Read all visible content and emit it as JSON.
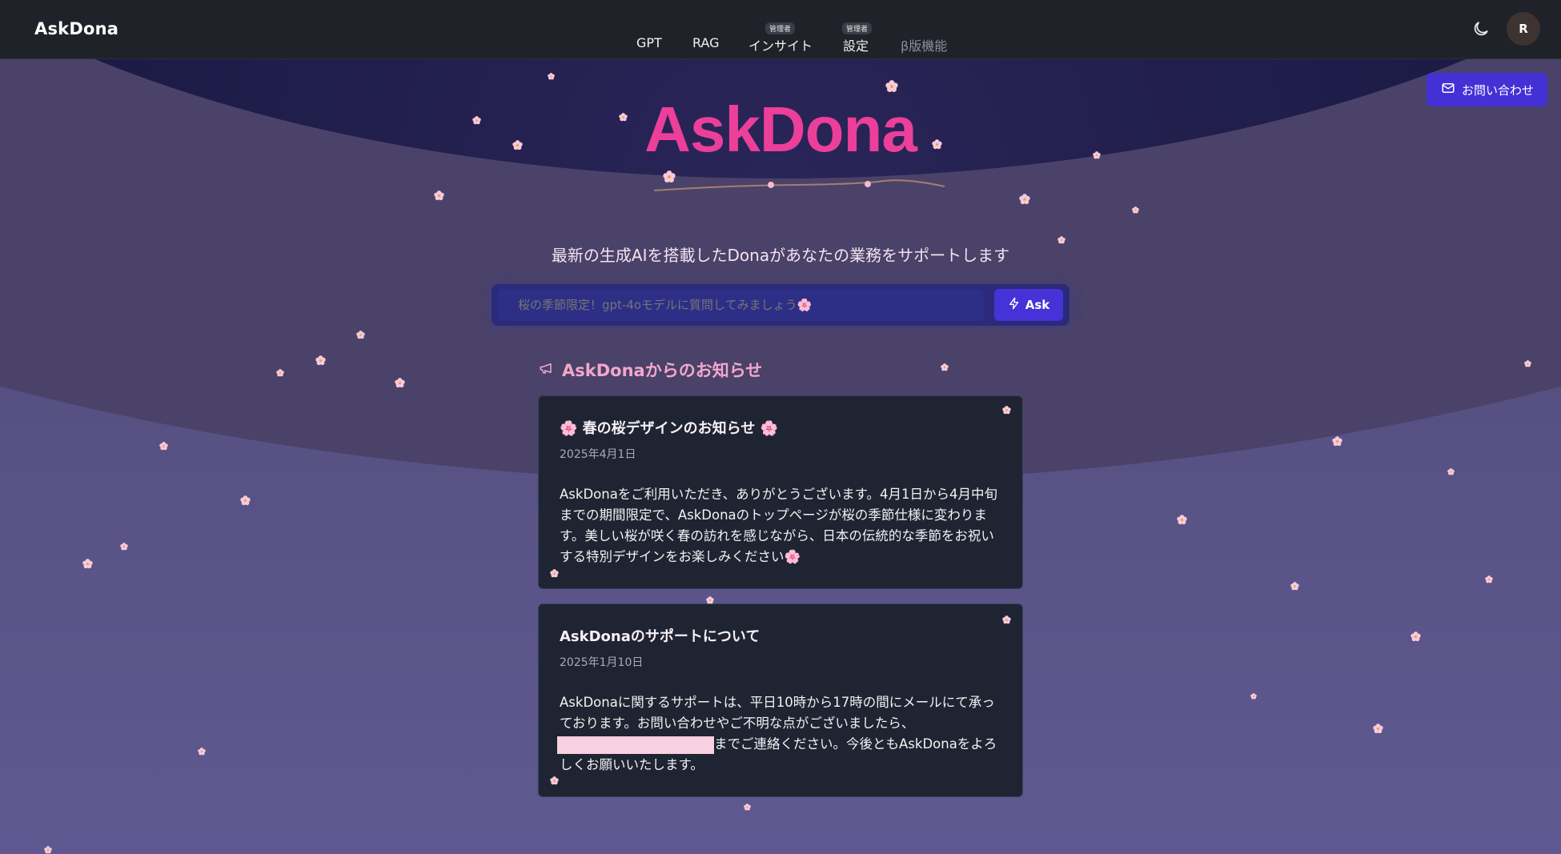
{
  "app": {
    "brand": "AskDona"
  },
  "nav": {
    "items": [
      {
        "label": "GPT",
        "badge": ""
      },
      {
        "label": "RAG",
        "badge": ""
      },
      {
        "label": "インサイト",
        "badge": "管理者"
      },
      {
        "label": "設定",
        "badge": "管理者"
      },
      {
        "label": "β版機能",
        "badge": ""
      }
    ],
    "avatar_initial": "R"
  },
  "contact": {
    "label": "お問い合わせ"
  },
  "hero": {
    "title": "AskDona",
    "subtitle": "最新の生成AIを搭載したDonaがあなたの業務をサポートします"
  },
  "search": {
    "placeholder": "桜の季節限定！gpt-4oモデルに質問してみましょう🌸",
    "button_label": "Ask"
  },
  "announcements": {
    "heading": "AskDonaからのお知らせ",
    "items": [
      {
        "title": "🌸 春の桜デザインのお知らせ 🌸",
        "date": "2025年4月1日",
        "body": "AskDonaをご利用いただき、ありがとうございます。4月1日から4月中旬までの期間限定で、AskDonaのトップページが桜の季節仕様に変わります。美しい桜が咲く春の訪れを感じながら、日本の伝統的な季節をお祝いする特別デザインをお楽しみください🌸"
      },
      {
        "title": "AskDonaのサポートについて",
        "date": "2025年1月10日",
        "body_before": "AskDonaに関するサポートは、平日10時から17時の間にメールにて承っております。お問い合わせやご不明な点がございましたら、",
        "body_after": "までご連絡ください。今後ともAskDonaをよろしくお願いいたします。"
      }
    ]
  },
  "colors": {
    "accent": "#4533d8",
    "title_pink": "#ec3f9a",
    "heading_pink": "#f3a7cd",
    "card_bg": "#1e2432",
    "nav_bg": "#1f2229"
  },
  "icons": [
    "moon-icon",
    "mail-icon",
    "lightning-icon",
    "megaphone-icon",
    "cherry-blossom-icon"
  ]
}
